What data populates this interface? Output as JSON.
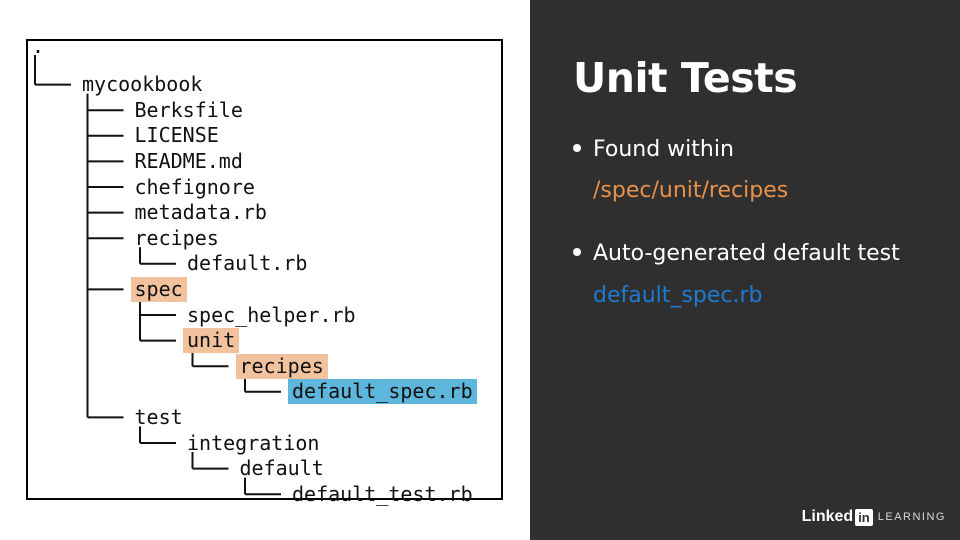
{
  "slide": {
    "title": "Unit Tests",
    "bullets": [
      {
        "text": "Found within",
        "detail": "/spec/unit/recipes",
        "detail_color": "#e8914a"
      },
      {
        "text": "Auto-generated default test",
        "detail": "default_spec.rb",
        "detail_color": "#1f7ad1"
      }
    ]
  },
  "tree": {
    "root": ".",
    "entries": [
      {
        "label": "mycookbook",
        "depth": 0,
        "highlight": "none"
      },
      {
        "label": "Berksfile",
        "depth": 1,
        "highlight": "none"
      },
      {
        "label": "LICENSE",
        "depth": 1,
        "highlight": "none"
      },
      {
        "label": "README.md",
        "depth": 1,
        "highlight": "none"
      },
      {
        "label": "chefignore",
        "depth": 1,
        "highlight": "none"
      },
      {
        "label": "metadata.rb",
        "depth": 1,
        "highlight": "none"
      },
      {
        "label": "recipes",
        "depth": 1,
        "highlight": "none"
      },
      {
        "label": "default.rb",
        "depth": 2,
        "highlight": "none"
      },
      {
        "label": "spec",
        "depth": 1,
        "highlight": "orange"
      },
      {
        "label": "spec_helper.rb",
        "depth": 2,
        "highlight": "none"
      },
      {
        "label": "unit",
        "depth": 2,
        "highlight": "orange"
      },
      {
        "label": "recipes",
        "depth": 3,
        "highlight": "orange"
      },
      {
        "label": "default_spec.rb",
        "depth": 4,
        "highlight": "blue"
      },
      {
        "label": "test",
        "depth": 1,
        "highlight": "none"
      },
      {
        "label": "integration",
        "depth": 2,
        "highlight": "none"
      },
      {
        "label": "default",
        "depth": 3,
        "highlight": "none"
      },
      {
        "label": "default_test.rb",
        "depth": 4,
        "highlight": "none"
      }
    ]
  },
  "branding": {
    "logo_word": "Linked",
    "logo_in": "in",
    "logo_suffix": "LEARNING"
  }
}
